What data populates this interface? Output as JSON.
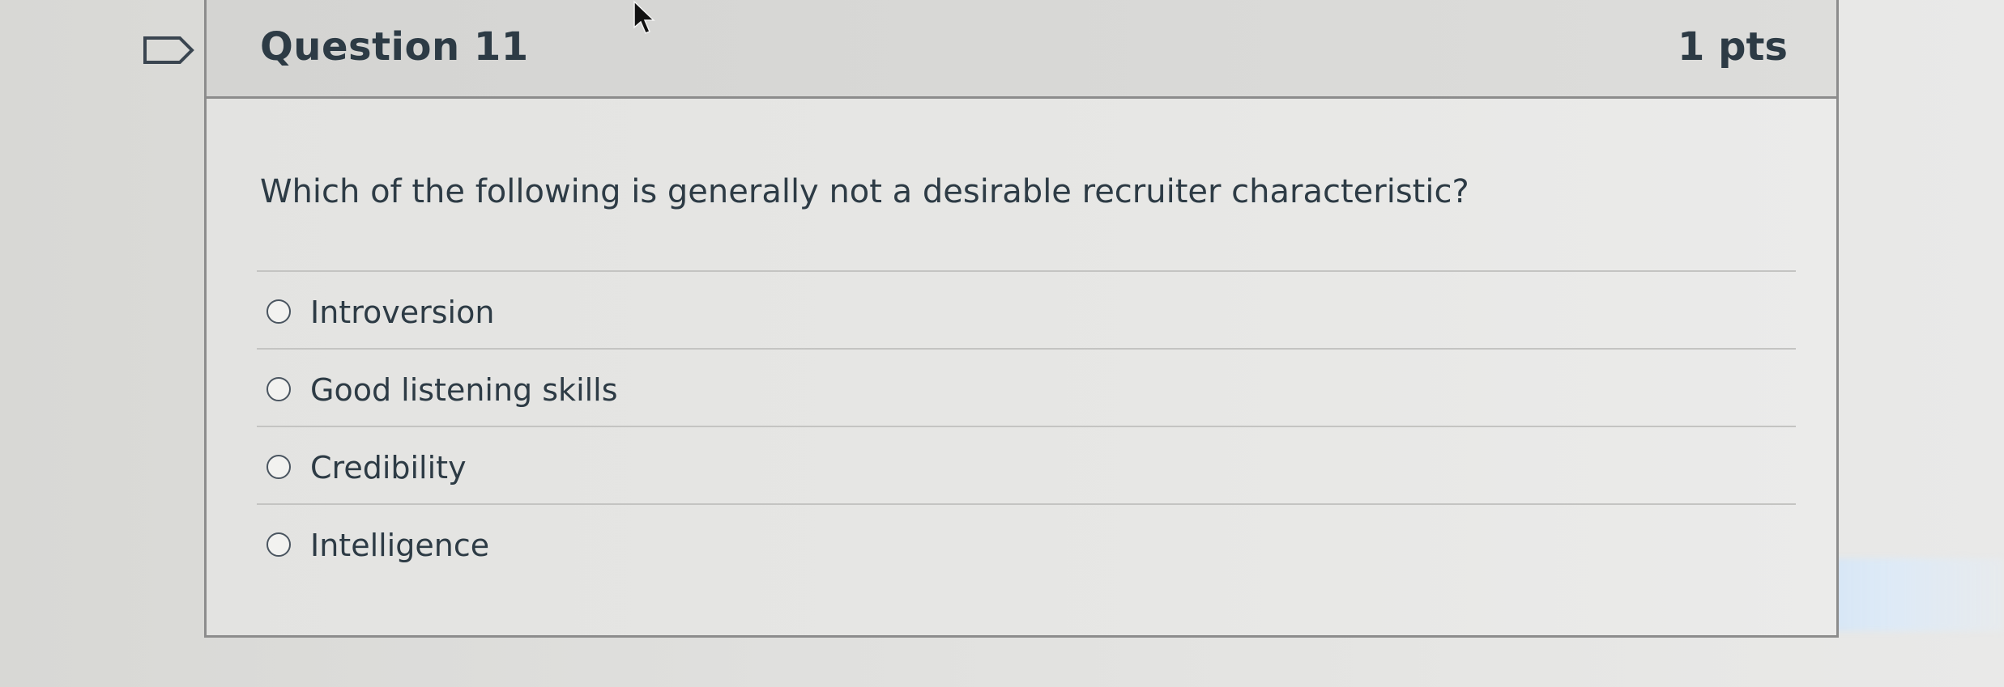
{
  "question": {
    "title": "Question 11",
    "points": "1 pts",
    "text": "Which of the following is generally not a desirable recruiter characteristic?",
    "answers": [
      {
        "label": "Introversion"
      },
      {
        "label": "Good listening skills"
      },
      {
        "label": "Credibility"
      },
      {
        "label": "Intelligence"
      }
    ]
  },
  "icons": {
    "flag": "flag-question-icon",
    "cursor": "mouse-cursor-icon",
    "radio": "radio-button-icon"
  },
  "colors": {
    "text": "#2d3b45",
    "border": "#8c8c8c",
    "header_bg": "#d9d9d7"
  }
}
